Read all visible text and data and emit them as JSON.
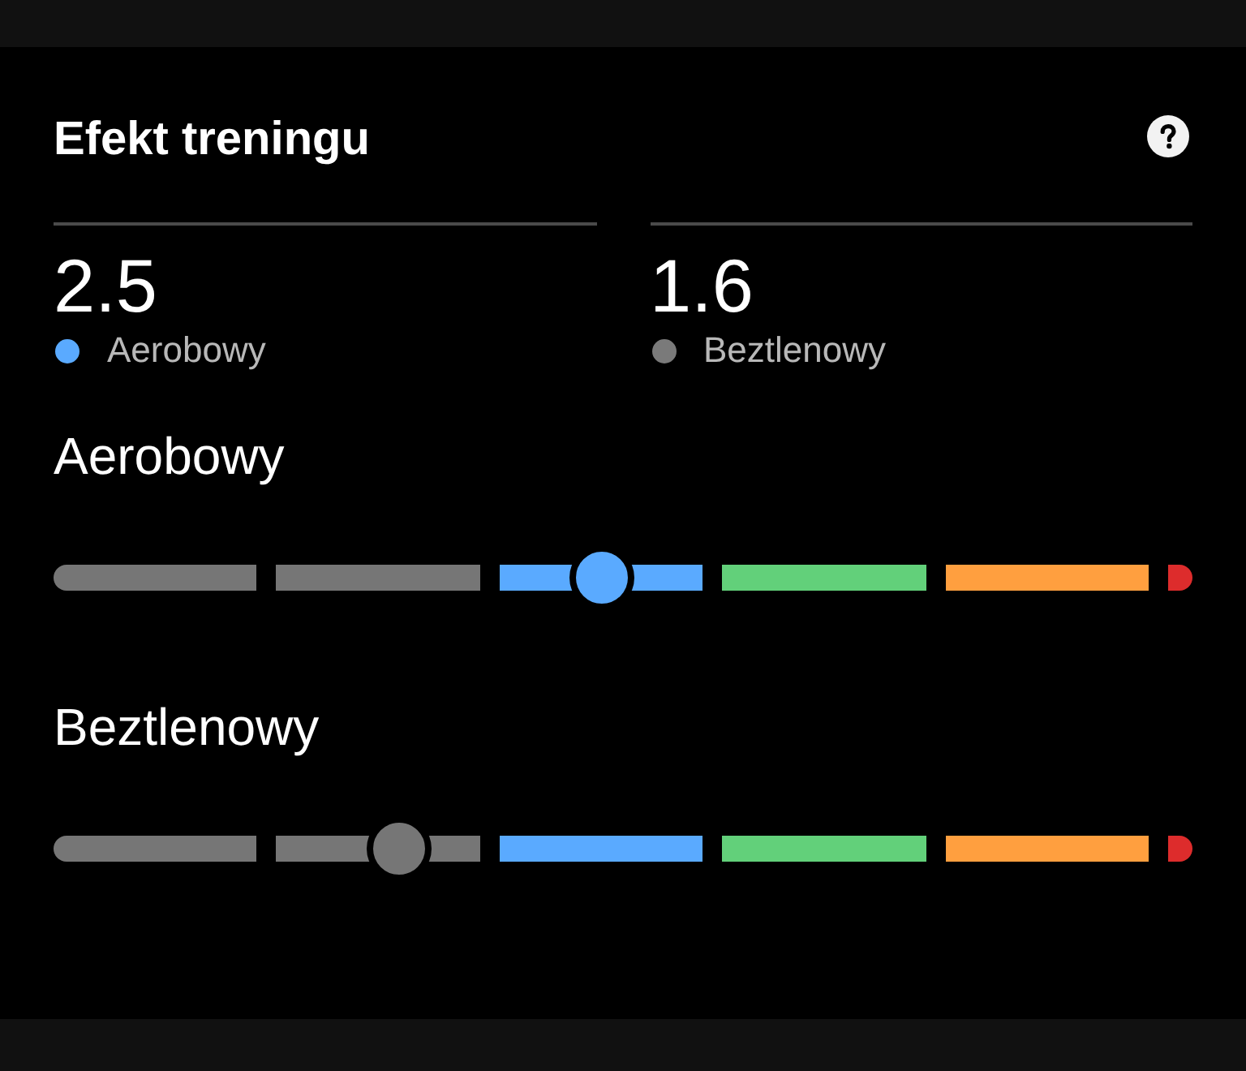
{
  "card": {
    "title": "Efekt treningu"
  },
  "summary": [
    {
      "value": "2.5",
      "label": "Aerobowy",
      "color": "#5aaaff"
    },
    {
      "value": "1.6",
      "label": "Beztlenowy",
      "color": "#7a7a7a"
    }
  ],
  "gauges": [
    {
      "title": "Aerobowy",
      "level": 0.5
    },
    {
      "title": "Beztlenowy",
      "level": 0.32
    }
  ]
}
